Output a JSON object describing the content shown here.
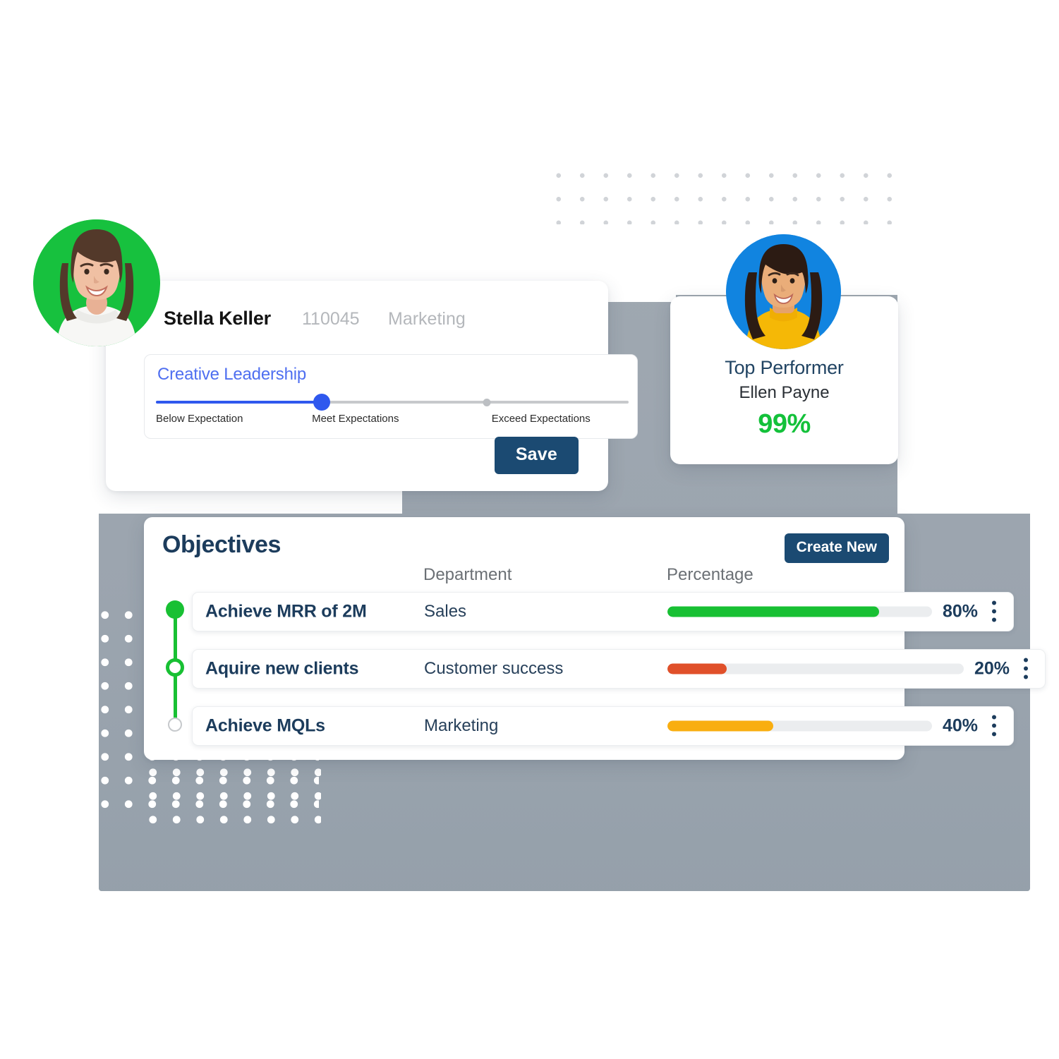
{
  "employee": {
    "name": "Stella Keller",
    "id": "110045",
    "department": "Marketing",
    "rating": {
      "competency": "Creative Leadership",
      "value_pct": 35,
      "marker_pct": 70,
      "scale": [
        {
          "label": "Below Expectation",
          "pos_pct": 0
        },
        {
          "label": "Meet Expectations",
          "pos_pct": 33
        },
        {
          "label": "Exceed Expectations",
          "pos_pct": 71
        }
      ]
    },
    "save_label": "Save"
  },
  "top_performer": {
    "title": "Top Performer",
    "name": "Ellen Payne",
    "percentage": "99%"
  },
  "objectives": {
    "title": "Objectives",
    "create_label": "Create New",
    "columns": {
      "name": "",
      "department": "Department",
      "percentage": "Percentage"
    },
    "rows": [
      {
        "name": "Achieve MRR of 2M",
        "department": "Sales",
        "percent_label": "80%",
        "percent": 80,
        "bar_color": "#18c033",
        "node": "filled"
      },
      {
        "name": "Aquire new clients",
        "department": "Customer success",
        "percent_label": "20%",
        "percent": 20,
        "bar_color": "#e0502a",
        "node": "ring"
      },
      {
        "name": "Achieve MQLs",
        "department": "Marketing",
        "percent_label": "40%",
        "percent": 40,
        "bar_color": "#f9ae10",
        "node": "ghost"
      }
    ]
  },
  "colors": {
    "accent_navy": "#1b4a72",
    "heading_navy": "#1c3c5c",
    "slider_blue": "#2f58ee",
    "competency_blue": "#4f6ff0",
    "green": "#18c033",
    "orange": "#e0502a",
    "amber": "#f9ae10",
    "avatar_green": "#17c13e",
    "avatar_blue": "#1184e0",
    "backdrop_gray": "#9aa3ab"
  }
}
